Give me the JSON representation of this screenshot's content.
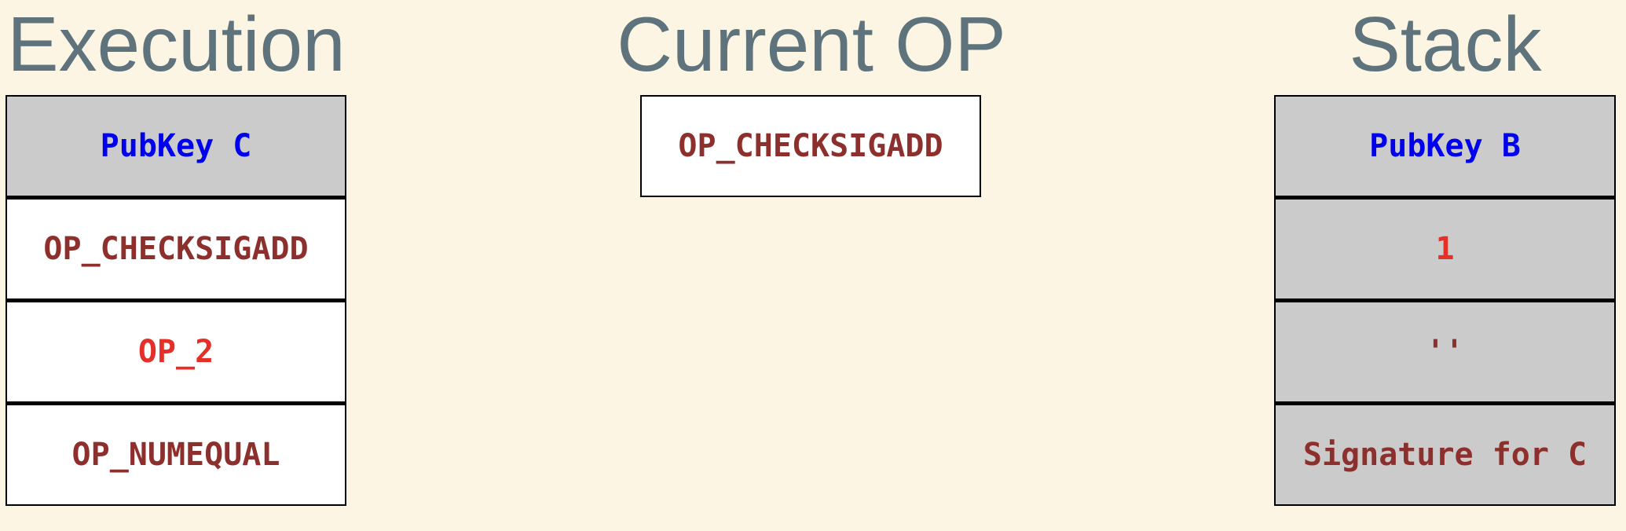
{
  "execution": {
    "title": "Execution",
    "items": [
      {
        "text": "PubKey C",
        "color": "#0000ee",
        "background": "#cbcbcb"
      },
      {
        "text": "OP_CHECKSIGADD",
        "color": "#8d2f2c",
        "background": "#ffffff"
      },
      {
        "text": "OP_2",
        "color": "#e5302a",
        "background": "#ffffff"
      },
      {
        "text": "OP_NUMEQUAL",
        "color": "#8d2f2c",
        "background": "#ffffff"
      }
    ]
  },
  "current_op": {
    "title": "Current OP",
    "value": "OP_CHECKSIGADD",
    "color": "#8d2f2c",
    "background": "#ffffff"
  },
  "stack": {
    "title": "Stack",
    "items": [
      {
        "text": "PubKey B",
        "color": "#0000ee",
        "background": "#cbcbcb"
      },
      {
        "text": "1",
        "color": "#e5302a",
        "background": "#cbcbcb"
      },
      {
        "text": "''",
        "color": "#8d2f2c",
        "background": "#cbcbcb"
      },
      {
        "text": "Signature for C",
        "color": "#8d2f2c",
        "background": "#cbcbcb"
      }
    ]
  },
  "colors": {
    "page_background": "#fcf5e3",
    "heading": "#5f737c",
    "border": "#000000"
  }
}
